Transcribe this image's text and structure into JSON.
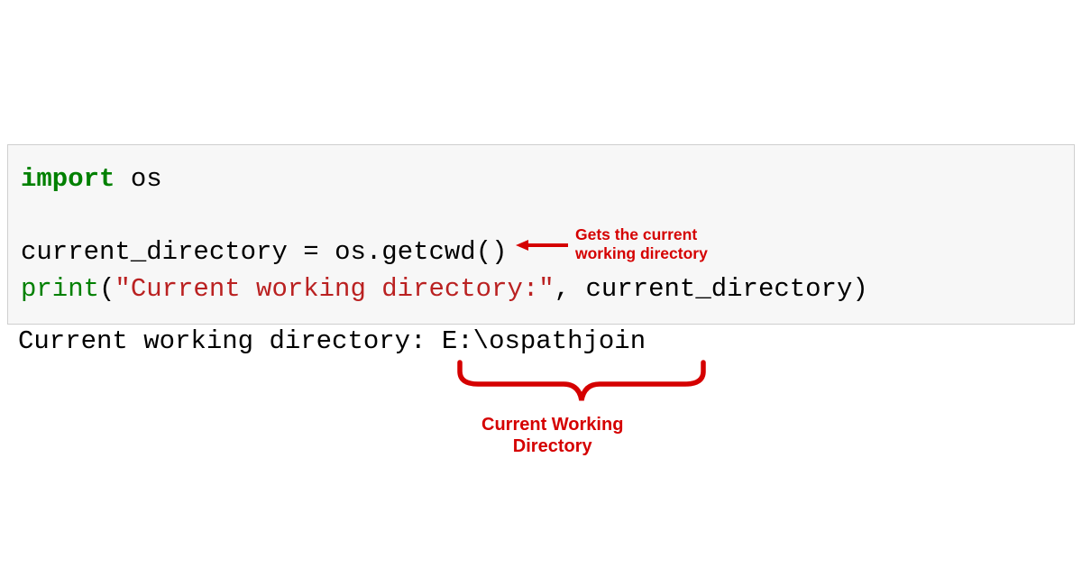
{
  "code": {
    "line1_kw": "import",
    "line1_mod": " os",
    "line3_var": "current_directory ",
    "line3_eq": "= ",
    "line3_call": "os.getcwd()",
    "line4_fn": "print",
    "line4_open": "(",
    "line4_str": "\"Current working directory:\"",
    "line4_comma": ", ",
    "line4_arg": "current_directory",
    "line4_close": ")"
  },
  "output": {
    "text": "Current working directory: E:\\ospathjoin"
  },
  "annotations": {
    "a1_line1": "Gets the current",
    "a1_line2": "working directory",
    "a2_line1": "Current Working",
    "a2_line2": "Directory"
  },
  "colors": {
    "keyword": "#008000",
    "string": "#BA2121",
    "annotation": "#d50000"
  }
}
